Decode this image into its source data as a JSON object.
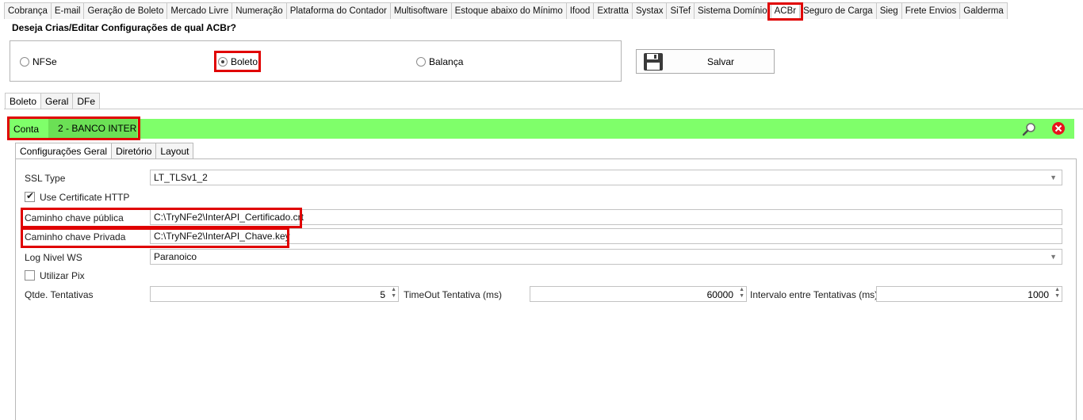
{
  "top_tabs": [
    "Cobrança",
    "E-mail",
    "Geração de Boleto",
    "Mercado Livre",
    "Numeração",
    "Plataforma do Contador",
    "Multisoftware",
    "Estoque abaixo do Mínimo",
    "Ifood",
    "Extratta",
    "Systax",
    "SiTef",
    "Sistema Domínio",
    "ACBr",
    "Seguro de Carga",
    "Sieg",
    "Frete Envios",
    "Galderma"
  ],
  "active_top_tab": "ACBr",
  "question": "Deseja Crias/Editar Configurações de qual ACBr?",
  "radios": {
    "nfse": "NFSe",
    "boleto": "Boleto",
    "balanca": "Balança",
    "selected": "Boleto"
  },
  "save_label": "Salvar",
  "sub_tabs": [
    "Boleto",
    "Geral",
    "DFe"
  ],
  "conta": {
    "label": "Conta",
    "value": "2 - BANCO INTER"
  },
  "inner_tabs": [
    "Configurações Geral",
    "Diretório",
    "Layout"
  ],
  "form": {
    "ssl_type_label": "SSL Type",
    "ssl_type_value": "LT_TLSv1_2",
    "use_cert_label": "Use Certificate HTTP",
    "use_cert_checked": true,
    "pub_key_label": "Caminho chave pública",
    "pub_key_value": "C:\\TryNFe2\\InterAPI_Certificado.crt",
    "priv_key_label": "Caminho chave Privada",
    "priv_key_value": "C:\\TryNFe2\\InterAPI_Chave.key",
    "log_label": "Log Nivel WS",
    "log_value": "Paranoico",
    "pix_label": "Utilizar Pix",
    "pix_checked": false,
    "tentativas_label": "Qtde. Tentativas",
    "tentativas_value": "5",
    "timeout_label": "TimeOut Tentativa (ms)",
    "timeout_value": "60000",
    "intervalo_label": "Intervalo entre Tentativas (ms)",
    "intervalo_value": "1000"
  },
  "colors": {
    "highlight_red": "#e00000",
    "conta_green": "#7fff6a",
    "conta_value_green": "#6be055"
  }
}
